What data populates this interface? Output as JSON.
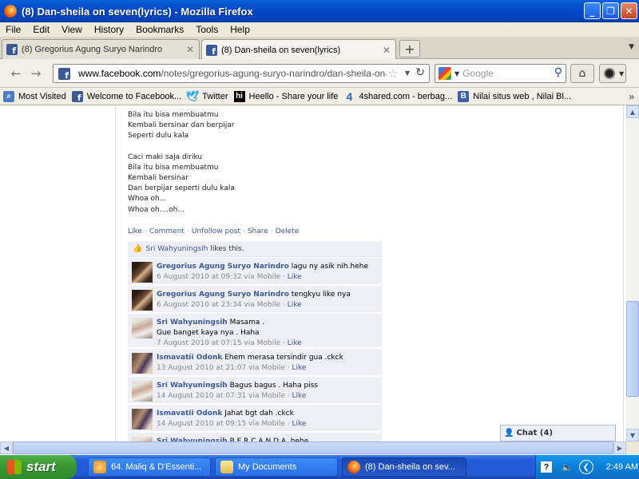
{
  "window": {
    "title": "(8) Dan-sheila on seven(lyrics) - Mozilla Firefox",
    "minimize": "_",
    "restore": "❐",
    "close": "✕"
  },
  "menu": [
    "File",
    "Edit",
    "View",
    "History",
    "Bookmarks",
    "Tools",
    "Help"
  ],
  "tabs": [
    {
      "label": "(8) Gregorius Agung Suryo Narindro",
      "active": false
    },
    {
      "label": "(8) Dan-sheila on seven(lyrics)",
      "active": true
    }
  ],
  "newtab_label": "+",
  "nav": {
    "url_host": "www.facebook.com",
    "url_path": "/notes/gregorius-agung-suryo-narindro/dan-sheila-on-seve",
    "search_placeholder": "Google"
  },
  "bookmarks": [
    {
      "label": "Most Visited",
      "icon": "most-visited-icon"
    },
    {
      "label": "Welcome to Facebook...",
      "icon": "facebook-icon"
    },
    {
      "label": "Twitter",
      "icon": "twitter-icon"
    },
    {
      "label": "Heello - Share your life",
      "icon": "heello-icon"
    },
    {
      "label": "4shared.com - berbag...",
      "icon": "4shared-icon"
    },
    {
      "label": "Nilai situs web , Nilai Bl...",
      "icon": "nilai-icon"
    }
  ],
  "lyrics": {
    "block1": [
      "Bila itu bisa membuatmu",
      "Kembali bersinar dan berpijar",
      "Seperti dulu kala"
    ],
    "block2": [
      "Caci maki saja diriku",
      "Bila itu bisa membuatmu",
      "Kembali bersinar",
      "Dan berpijar seperti dulu kala",
      "Whoa oh...",
      "Whoa oh....oh..."
    ]
  },
  "post_actions": [
    "Like",
    "Comment",
    "Unfollow post",
    "Share",
    "Delete"
  ],
  "likes": {
    "name": "Sri Wahyuningsih",
    "text": "likes this."
  },
  "comments": [
    {
      "author": "Gregorius Agung Suryo Narindro",
      "text": "lagu ny asik nih.hehe",
      "text2": "",
      "meta": "6 August 2010 at 09:32 via Mobile",
      "like": "Like",
      "avatar": "g"
    },
    {
      "author": "Gregorius Agung Suryo Narindro",
      "text": "tengkyu like nya",
      "text2": "",
      "meta": "6 August 2010 at 23:34 via Mobile",
      "like": "Like",
      "avatar": "g"
    },
    {
      "author": "Sri Wahyuningsih",
      "text": "Masama .",
      "text2": "Gue banget kaya nya . Haha",
      "meta": "7 August 2010 at 07:15 via Mobile",
      "like": "Like",
      "avatar": "s"
    },
    {
      "author": "Ismavatii Odonk",
      "text": "Ehem merasa tersindir gua .ckck",
      "text2": "",
      "meta": "13 August 2010 at 21:07 via Mobile",
      "like": "Like",
      "avatar": "i"
    },
    {
      "author": "Sri Wahyuningsih",
      "text": "Bagus bagus . Haha piss",
      "text2": "",
      "meta": "14 August 2010 at 07:31 via Mobile",
      "like": "Like",
      "avatar": "s"
    },
    {
      "author": "Ismavatii Odonk",
      "text": "Jahat bgt dah .ckck",
      "text2": "",
      "meta": "14 August 2010 at 09:15 via Mobile",
      "like": "Like",
      "avatar": "i"
    },
    {
      "author": "Sri Wahyuningsih",
      "text": "B E R C A N D A .hehe",
      "text2": "",
      "meta": "",
      "like": "",
      "avatar": "s"
    }
  ],
  "chat": {
    "label": "Chat (4)"
  },
  "taskbar": {
    "start": "start",
    "tasks": [
      {
        "label": "64. Maliq & D'Essenti...",
        "icon": "wmp"
      },
      {
        "label": "My Documents",
        "icon": "folder"
      },
      {
        "label": "(8) Dan-sheila on sev...",
        "icon": "ff"
      }
    ],
    "help_glyph": "?",
    "clock": "2:49 AM"
  }
}
